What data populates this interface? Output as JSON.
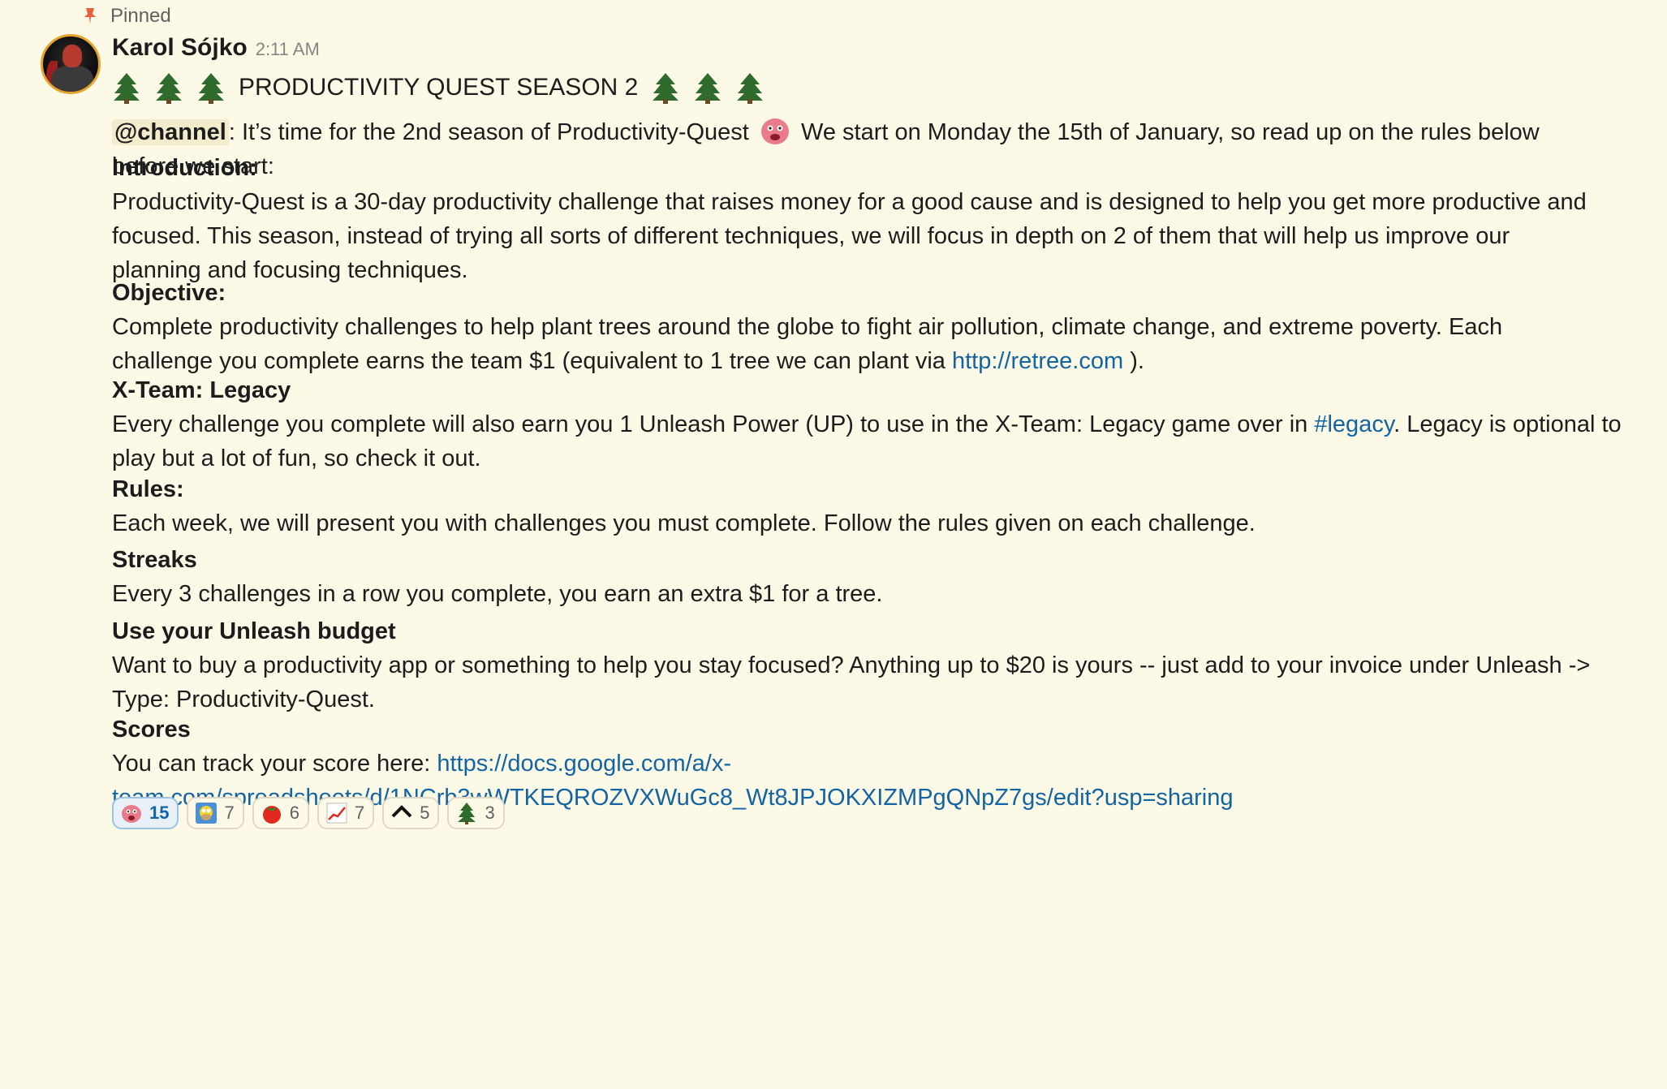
{
  "pinned_label": "Pinned",
  "message": {
    "author": "Karol Sójko",
    "timestamp": "2:11 AM",
    "title": "PRODUCTIVITY QUEST SEASON 2",
    "intro_mention": "@channel",
    "intro_text_1": ": It’s time for the 2nd season of Productivity-Quest",
    "intro_text_2": "We start on Monday the 15th of January, so read up on the rules below",
    "intro_text_3": "before we start:",
    "introduction_heading": "Introduction:",
    "introduction_lines": [
      "Productivity-Quest is a 30-day productivity challenge that raises money for a good cause and is designed to help you get more productive and",
      "focused. This season, instead of trying all sorts of different techniques, we will focus in depth on 2 of them that will help us improve our",
      "planning and focusing techniques."
    ],
    "objective_heading": "Objective:",
    "objective_line_1": "Complete productivity challenges to help plant trees around the globe to fight air pollution, climate change, and extreme poverty. Each",
    "objective_line_2_prefix": "challenge you complete earns the team $1 (equivalent to 1 tree we can plant via",
    "objective_link": "http://retree.com",
    "objective_line_2_suffix": ").",
    "legacy_heading": "X-Team: Legacy",
    "legacy_line_1_prefix": "Every challenge you complete will also earn you 1 Unleash Power (UP) to use in the X-Team: Legacy game over in",
    "legacy_channel_link": "#legacy",
    "legacy_line_1_suffix": ". Legacy is optional to",
    "legacy_line_2": "play but a lot of fun, so check it out.",
    "rules_heading": "Rules:",
    "rules_line": "Each week, we will present you with challenges you must complete. Follow the rules given on each challenge.",
    "streaks_heading": "Streaks",
    "streaks_line": "Every 3 challenges in a row you complete, you earn an extra $1 for a tree.",
    "budget_heading": "Use your Unleash budget",
    "budget_line_1": "Want to buy a productivity app or something to help you stay focused? Anything up to $20 is yours -- just add to your invoice under Unleash ->",
    "budget_line_2": "Type: Productivity-Quest.",
    "scores_heading": "Scores",
    "scores_prefix": "You can track your score here:",
    "scores_link_1": "https://docs.google.com/a/x-",
    "scores_link_2": "team.com/spreadsheets/d/1NCrb3wWTKEQROZVXWuGc8_Wt8JPJOKXIZMPgQNpZ7gs/edit?usp=sharing"
  },
  "reactions": [
    {
      "icon": "pink-creature-emoji",
      "count": "15",
      "active": true
    },
    {
      "icon": "homer-emoji",
      "count": "7",
      "active": false
    },
    {
      "icon": "tomato-emoji",
      "count": "6",
      "active": false
    },
    {
      "icon": "chart-increasing-emoji",
      "count": "7",
      "active": false
    },
    {
      "icon": "chevron-up-emoji",
      "count": "5",
      "active": false
    },
    {
      "icon": "evergreen-tree-emoji",
      "count": "3",
      "active": false
    }
  ],
  "colors": {
    "background": "#fdf9e7",
    "link": "#1264a3",
    "pin": "#e8603c"
  }
}
